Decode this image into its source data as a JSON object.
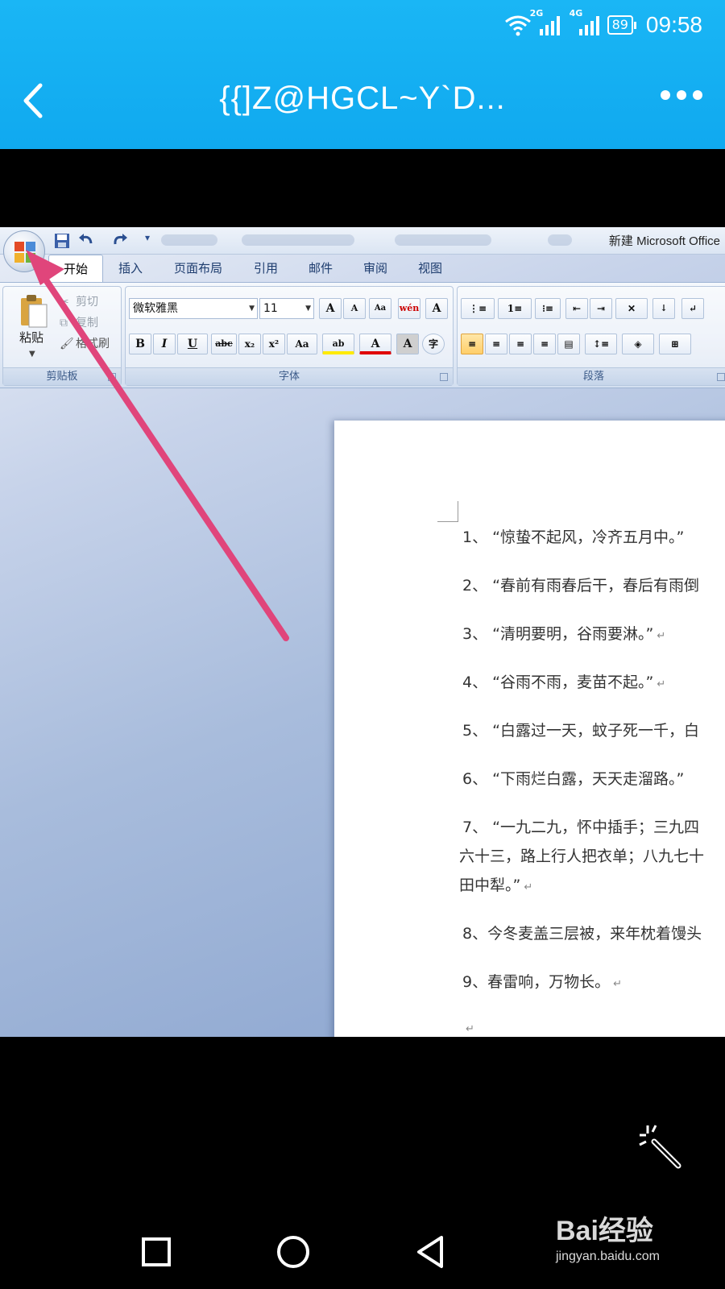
{
  "status_bar": {
    "net1": "2G",
    "net2": "4G",
    "battery": "89",
    "time": "09:58"
  },
  "header": {
    "title": "{{]Z@HGCL~Y`D..."
  },
  "word": {
    "window_title": "新建 Microsoft Office",
    "tabs": [
      "开始",
      "插入",
      "页面布局",
      "引用",
      "邮件",
      "审阅",
      "视图"
    ],
    "clipboard": {
      "paste": "粘贴",
      "cut": "剪切",
      "copy": "复制",
      "format_painter": "格式刷",
      "group_label": "剪贴板"
    },
    "font": {
      "family": "微软雅黑",
      "size": "11",
      "group_label": "字体",
      "bold": "B",
      "italic": "I",
      "underline": "U",
      "strike": "abc",
      "subscript": "x₂",
      "superscript": "x²",
      "case": "Aa",
      "grow": "A",
      "shrink": "A",
      "wen": "wén",
      "font_color": "A"
    },
    "paragraph": {
      "group_label": "段落"
    },
    "document_lines": [
      "1、 “惊蛰不起风，冷齐五月中。”",
      "2、 “春前有雨春后干，春后有雨倒",
      "3、 “清明要明，谷雨要淋。”",
      "4、 “谷雨不雨，麦苗不起。”",
      "5、 “白露过一天，蚊子死一千，白",
      "6、 “下雨烂白露，天天走溜路。”",
      "7、 “一九二九，怀中插手；三九四",
      "六十三，路上行人把衣单；八九七十",
      "田中犁。”",
      "8、今冬麦盖三层被，来年枕着馒头",
      "9、春雷响，万物长。"
    ]
  },
  "watermark": {
    "brand": "Bai经验",
    "url": "jingyan.baidu.com"
  },
  "colors": {
    "header_blue": "#12adf1",
    "arrow_pink": "#e0457b"
  }
}
